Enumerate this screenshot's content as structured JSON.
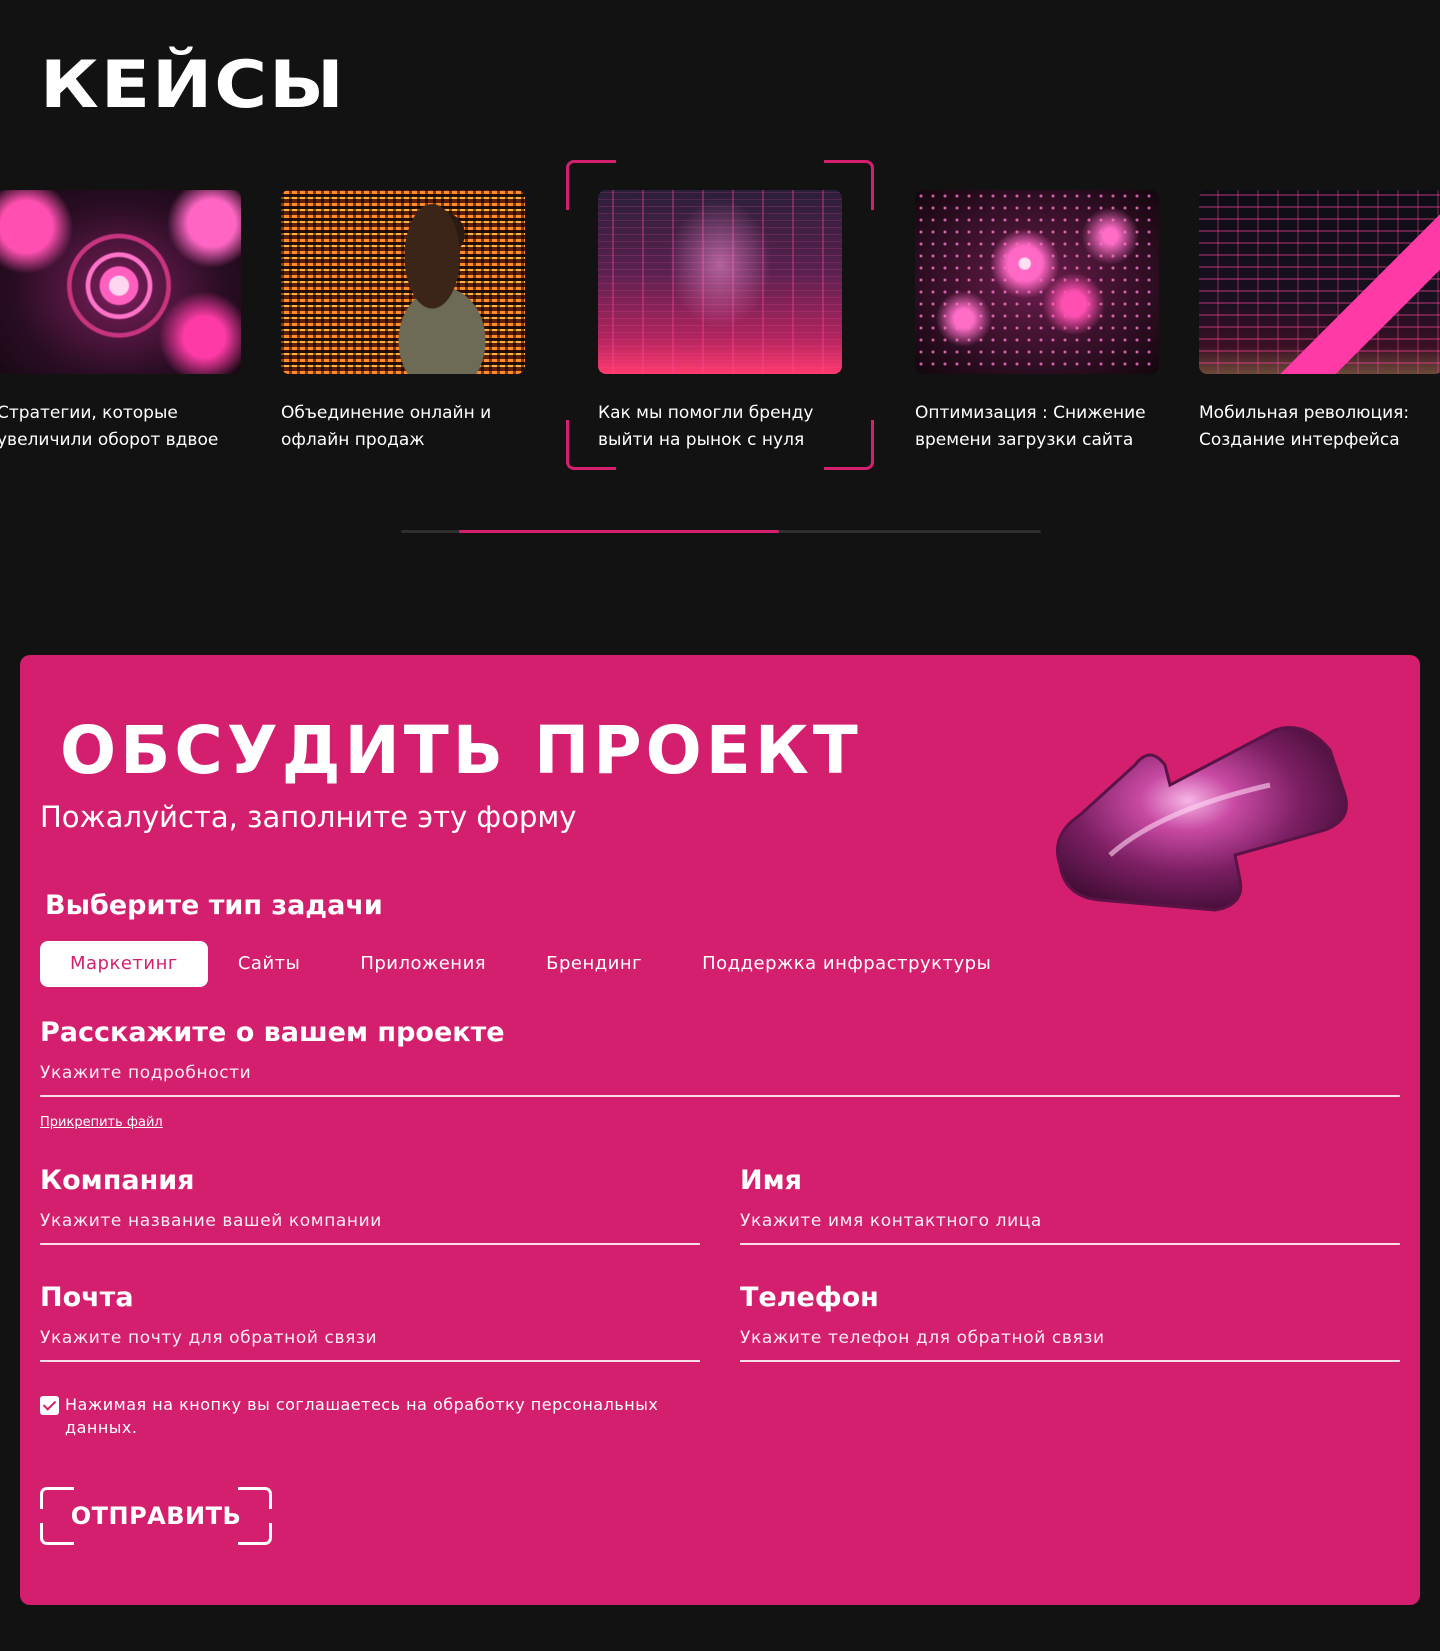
{
  "cases": {
    "title": "КЕЙСЫ",
    "items": [
      {
        "caption": "Стратегии, которые увеличили оборот вдвое"
      },
      {
        "caption": "Объединение онлайн и офлайн продаж"
      },
      {
        "caption": "Как мы помогли бренду выйти на рынок с нуля"
      },
      {
        "caption": "Оптимизация : Снижение времени загрузки сайта"
      },
      {
        "caption": "Мобильная революция: Создание интерфейса"
      }
    ],
    "active_index": 2,
    "scroll_progress": {
      "start": 0.09,
      "end": 0.59
    }
  },
  "form": {
    "title": "ОБСУДИТЬ ПРОЕКТ",
    "subtitle": "Пожалуйста, заполните эту форму",
    "task_heading": "Выберите тип задачи",
    "task_tabs": [
      {
        "label": "Маркетинг",
        "active": true
      },
      {
        "label": "Сайты",
        "active": false
      },
      {
        "label": "Приложения",
        "active": false
      },
      {
        "label": "Брендинг",
        "active": false
      },
      {
        "label": "Поддержка инфраструктуры",
        "active": false
      }
    ],
    "project": {
      "label": "Расскажите о вашем проекте",
      "placeholder": "Укажите подробности"
    },
    "attach_label": "Прикрепить файл",
    "company": {
      "label": "Компания",
      "placeholder": "Укажите название вашей компании"
    },
    "name": {
      "label": "Имя",
      "placeholder": "Укажите имя контактного лица"
    },
    "email": {
      "label": "Почта",
      "placeholder": "Укажите почту для обратной связи"
    },
    "phone": {
      "label": "Телефон",
      "placeholder": "Укажите телефон для обратной связи"
    },
    "consent": {
      "checked": true,
      "text": "Нажимая на кнопку вы соглашаетесь на обработку персональных данных."
    },
    "submit_label": "ОТПРАВИТЬ"
  },
  "colors": {
    "background": "#121212",
    "accent": "#d41f6e",
    "text": "#ffffff",
    "track": "#2e2e2e"
  },
  "icons": {
    "checkbox": "checkmark-icon",
    "decor": "arrow-3d-icon"
  }
}
